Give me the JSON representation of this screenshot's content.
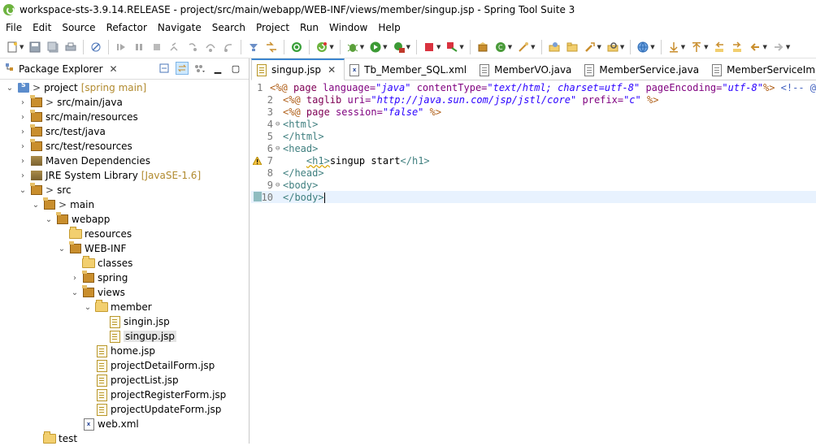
{
  "window": {
    "title": "workspace-sts-3.9.14.RELEASE - project/src/main/webapp/WEB-INF/views/member/singup.jsp - Spring Tool Suite 3"
  },
  "menu": [
    "File",
    "Edit",
    "Source",
    "Refactor",
    "Navigate",
    "Search",
    "Project",
    "Run",
    "Window",
    "Help"
  ],
  "toolbar": {
    "icons": [
      "new-icon",
      "save-icon",
      "save-all-icon",
      "print-icon",
      "debug-skip-icon",
      "suspend-icon",
      "pause-icon",
      "terminate-icon",
      "step-icon",
      "step-over-icon",
      "step-return-icon",
      "cut-icon",
      "run-ant-icon",
      "stop-icon",
      "boot-dashboard-icon",
      "debug-icon",
      "run-icon",
      "run-external-icon",
      "stop-server-icon",
      "server-icon",
      "new-class-icon",
      "refresh-icon",
      "open-type-icon",
      "open-resource-icon",
      "search-icon",
      "globe-icon",
      "next-annotation-icon",
      "prev-annotation-icon",
      "back-icon",
      "forward-icon"
    ]
  },
  "package_explorer": {
    "title": "Package Explorer",
    "tree": [
      {
        "label": "project",
        "extra": "[spring main]",
        "prefix": ">",
        "expanded": true,
        "icon": "project-icon"
      },
      {
        "label": "src/main/java",
        "prefix": ">",
        "expanded": false,
        "icon": "package-folder-icon"
      },
      {
        "label": "src/main/resources",
        "prefix": "",
        "expanded": false,
        "icon": "package-folder-icon"
      },
      {
        "label": "src/test/java",
        "prefix": "",
        "expanded": false,
        "icon": "package-folder-icon"
      },
      {
        "label": "src/test/resources",
        "prefix": "",
        "expanded": false,
        "icon": "package-folder-icon"
      },
      {
        "label": "Maven Dependencies",
        "prefix": "",
        "expanded": false,
        "icon": "library-icon"
      },
      {
        "label": "JRE System Library",
        "extra": "[JavaSE-1.6]",
        "prefix": "",
        "expanded": false,
        "icon": "library-icon"
      },
      {
        "label": "src",
        "prefix": ">",
        "expanded": true,
        "icon": "source-folder-icon"
      },
      {
        "label": "main",
        "prefix": ">",
        "expanded": true,
        "icon": "source-folder-icon"
      },
      {
        "label": "webapp",
        "prefix": "",
        "expanded": true,
        "icon": "source-folder-icon"
      },
      {
        "label": "resources",
        "prefix": "",
        "expanded": null,
        "icon": "folder-icon"
      },
      {
        "label": "WEB-INF",
        "prefix": "",
        "expanded": true,
        "icon": "source-folder-icon"
      },
      {
        "label": "classes",
        "prefix": "",
        "expanded": null,
        "icon": "folder-icon"
      },
      {
        "label": "spring",
        "prefix": "",
        "expanded": false,
        "icon": "source-folder-icon"
      },
      {
        "label": "views",
        "prefix": "",
        "expanded": true,
        "icon": "source-folder-icon"
      },
      {
        "label": "member",
        "prefix": "",
        "expanded": true,
        "icon": "folder-icon"
      },
      {
        "label": "singin.jsp",
        "prefix": "",
        "expanded": null,
        "icon": "jsp-file-icon"
      },
      {
        "label": "singup.jsp",
        "prefix": "",
        "expanded": null,
        "icon": "jsp-file-icon",
        "selected": true
      },
      {
        "label": "home.jsp",
        "prefix": "",
        "expanded": null,
        "icon": "jsp-file-icon"
      },
      {
        "label": "projectDetailForm.jsp",
        "prefix": "",
        "expanded": null,
        "icon": "jsp-file-icon"
      },
      {
        "label": "projectList.jsp",
        "prefix": "",
        "expanded": null,
        "icon": "jsp-file-icon"
      },
      {
        "label": "projectRegisterForm.jsp",
        "prefix": "",
        "expanded": null,
        "icon": "jsp-file-icon"
      },
      {
        "label": "projectUpdateForm.jsp",
        "prefix": "",
        "expanded": null,
        "icon": "jsp-file-icon"
      },
      {
        "label": "web.xml",
        "prefix": "",
        "expanded": null,
        "icon": "xml-file-icon"
      },
      {
        "label": "test",
        "prefix": "",
        "expanded": null,
        "icon": "folder-icon"
      }
    ]
  },
  "editor": {
    "tabs": [
      {
        "label": "singup.jsp",
        "active": true,
        "close": "✕"
      },
      {
        "label": "Tb_Member_SQL.xml",
        "active": false
      },
      {
        "label": "MemberVO.java",
        "active": false
      },
      {
        "label": "MemberService.java",
        "active": false
      },
      {
        "label": "MemberServiceImpl.java",
        "active": false
      }
    ],
    "line_numbers": [
      "1",
      "2",
      "3",
      "4",
      "5",
      "6",
      "7",
      "8",
      "9",
      "10"
    ],
    "lines": [
      [
        [
          "k-dir",
          "<%@ "
        ],
        [
          "k-kw",
          "page "
        ],
        [
          "k-attr",
          "language="
        ],
        [
          "k-str",
          "\"java\""
        ],
        [
          "k-attr",
          " contentType="
        ],
        [
          "k-str",
          "\"text/html; charset=utf-8\""
        ],
        [
          "k-attr",
          " pageEncoding="
        ],
        [
          "k-str",
          "\"utf-8\""
        ],
        [
          "k-dir",
          "%>"
        ],
        [
          "k-cmt",
          " <!-- @"
        ]
      ],
      [
        [
          "k-dir",
          "<%@ "
        ],
        [
          "k-kw",
          "taglib "
        ],
        [
          "k-attr",
          "uri="
        ],
        [
          "k-str",
          "\"http://java.sun.com/jsp/jstl/core\""
        ],
        [
          "k-attr",
          " prefix="
        ],
        [
          "k-str",
          "\"c\""
        ],
        [
          "k-dir",
          " %>"
        ]
      ],
      [
        [
          "k-dir",
          "<%@ "
        ],
        [
          "k-kw",
          "page "
        ],
        [
          "k-attr",
          "session="
        ],
        [
          "k-str",
          "\"false\""
        ],
        [
          "k-dir",
          " %>"
        ]
      ],
      [
        [
          "k-tag",
          "<html>"
        ]
      ],
      [
        [
          "k-tag",
          "</html>"
        ]
      ],
      [
        [
          "k-tag",
          "<head>"
        ]
      ],
      [
        [
          "",
          "    "
        ],
        [
          "k-tag",
          "<h1>"
        ],
        [
          "",
          "singup start"
        ],
        [
          "k-tag",
          "</h1>"
        ]
      ],
      [
        [
          "k-tag",
          "</head>"
        ]
      ],
      [
        [
          "k-tag",
          "<body>"
        ]
      ],
      [
        [
          "k-tag",
          "</body>"
        ]
      ]
    ],
    "fold_markers": [
      "",
      "",
      "",
      "⊖",
      "",
      "⊖",
      "",
      "",
      "⊖",
      ""
    ],
    "warning_line": "7",
    "current_line": "10"
  }
}
